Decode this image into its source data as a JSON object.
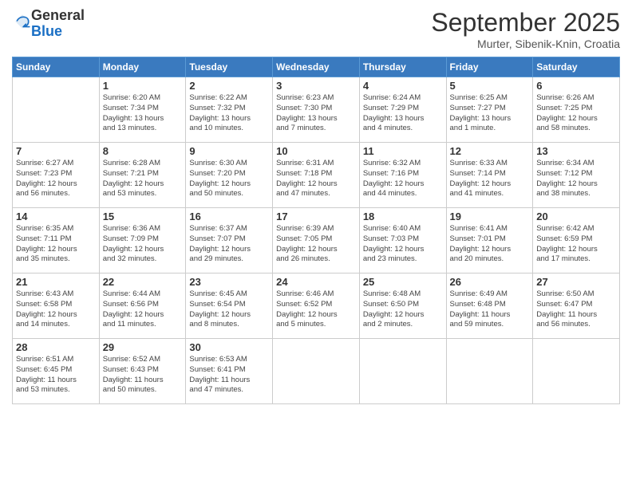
{
  "header": {
    "logo_general": "General",
    "logo_blue": "Blue",
    "month_title": "September 2025",
    "location": "Murter, Sibenik-Knin, Croatia"
  },
  "weekdays": [
    "Sunday",
    "Monday",
    "Tuesday",
    "Wednesday",
    "Thursday",
    "Friday",
    "Saturday"
  ],
  "weeks": [
    [
      {
        "day": "",
        "info": ""
      },
      {
        "day": "1",
        "info": "Sunrise: 6:20 AM\nSunset: 7:34 PM\nDaylight: 13 hours\nand 13 minutes."
      },
      {
        "day": "2",
        "info": "Sunrise: 6:22 AM\nSunset: 7:32 PM\nDaylight: 13 hours\nand 10 minutes."
      },
      {
        "day": "3",
        "info": "Sunrise: 6:23 AM\nSunset: 7:30 PM\nDaylight: 13 hours\nand 7 minutes."
      },
      {
        "day": "4",
        "info": "Sunrise: 6:24 AM\nSunset: 7:29 PM\nDaylight: 13 hours\nand 4 minutes."
      },
      {
        "day": "5",
        "info": "Sunrise: 6:25 AM\nSunset: 7:27 PM\nDaylight: 13 hours\nand 1 minute."
      },
      {
        "day": "6",
        "info": "Sunrise: 6:26 AM\nSunset: 7:25 PM\nDaylight: 12 hours\nand 58 minutes."
      }
    ],
    [
      {
        "day": "7",
        "info": "Sunrise: 6:27 AM\nSunset: 7:23 PM\nDaylight: 12 hours\nand 56 minutes."
      },
      {
        "day": "8",
        "info": "Sunrise: 6:28 AM\nSunset: 7:21 PM\nDaylight: 12 hours\nand 53 minutes."
      },
      {
        "day": "9",
        "info": "Sunrise: 6:30 AM\nSunset: 7:20 PM\nDaylight: 12 hours\nand 50 minutes."
      },
      {
        "day": "10",
        "info": "Sunrise: 6:31 AM\nSunset: 7:18 PM\nDaylight: 12 hours\nand 47 minutes."
      },
      {
        "day": "11",
        "info": "Sunrise: 6:32 AM\nSunset: 7:16 PM\nDaylight: 12 hours\nand 44 minutes."
      },
      {
        "day": "12",
        "info": "Sunrise: 6:33 AM\nSunset: 7:14 PM\nDaylight: 12 hours\nand 41 minutes."
      },
      {
        "day": "13",
        "info": "Sunrise: 6:34 AM\nSunset: 7:12 PM\nDaylight: 12 hours\nand 38 minutes."
      }
    ],
    [
      {
        "day": "14",
        "info": "Sunrise: 6:35 AM\nSunset: 7:11 PM\nDaylight: 12 hours\nand 35 minutes."
      },
      {
        "day": "15",
        "info": "Sunrise: 6:36 AM\nSunset: 7:09 PM\nDaylight: 12 hours\nand 32 minutes."
      },
      {
        "day": "16",
        "info": "Sunrise: 6:37 AM\nSunset: 7:07 PM\nDaylight: 12 hours\nand 29 minutes."
      },
      {
        "day": "17",
        "info": "Sunrise: 6:39 AM\nSunset: 7:05 PM\nDaylight: 12 hours\nand 26 minutes."
      },
      {
        "day": "18",
        "info": "Sunrise: 6:40 AM\nSunset: 7:03 PM\nDaylight: 12 hours\nand 23 minutes."
      },
      {
        "day": "19",
        "info": "Sunrise: 6:41 AM\nSunset: 7:01 PM\nDaylight: 12 hours\nand 20 minutes."
      },
      {
        "day": "20",
        "info": "Sunrise: 6:42 AM\nSunset: 6:59 PM\nDaylight: 12 hours\nand 17 minutes."
      }
    ],
    [
      {
        "day": "21",
        "info": "Sunrise: 6:43 AM\nSunset: 6:58 PM\nDaylight: 12 hours\nand 14 minutes."
      },
      {
        "day": "22",
        "info": "Sunrise: 6:44 AM\nSunset: 6:56 PM\nDaylight: 12 hours\nand 11 minutes."
      },
      {
        "day": "23",
        "info": "Sunrise: 6:45 AM\nSunset: 6:54 PM\nDaylight: 12 hours\nand 8 minutes."
      },
      {
        "day": "24",
        "info": "Sunrise: 6:46 AM\nSunset: 6:52 PM\nDaylight: 12 hours\nand 5 minutes."
      },
      {
        "day": "25",
        "info": "Sunrise: 6:48 AM\nSunset: 6:50 PM\nDaylight: 12 hours\nand 2 minutes."
      },
      {
        "day": "26",
        "info": "Sunrise: 6:49 AM\nSunset: 6:48 PM\nDaylight: 11 hours\nand 59 minutes."
      },
      {
        "day": "27",
        "info": "Sunrise: 6:50 AM\nSunset: 6:47 PM\nDaylight: 11 hours\nand 56 minutes."
      }
    ],
    [
      {
        "day": "28",
        "info": "Sunrise: 6:51 AM\nSunset: 6:45 PM\nDaylight: 11 hours\nand 53 minutes."
      },
      {
        "day": "29",
        "info": "Sunrise: 6:52 AM\nSunset: 6:43 PM\nDaylight: 11 hours\nand 50 minutes."
      },
      {
        "day": "30",
        "info": "Sunrise: 6:53 AM\nSunset: 6:41 PM\nDaylight: 11 hours\nand 47 minutes."
      },
      {
        "day": "",
        "info": ""
      },
      {
        "day": "",
        "info": ""
      },
      {
        "day": "",
        "info": ""
      },
      {
        "day": "",
        "info": ""
      }
    ]
  ]
}
